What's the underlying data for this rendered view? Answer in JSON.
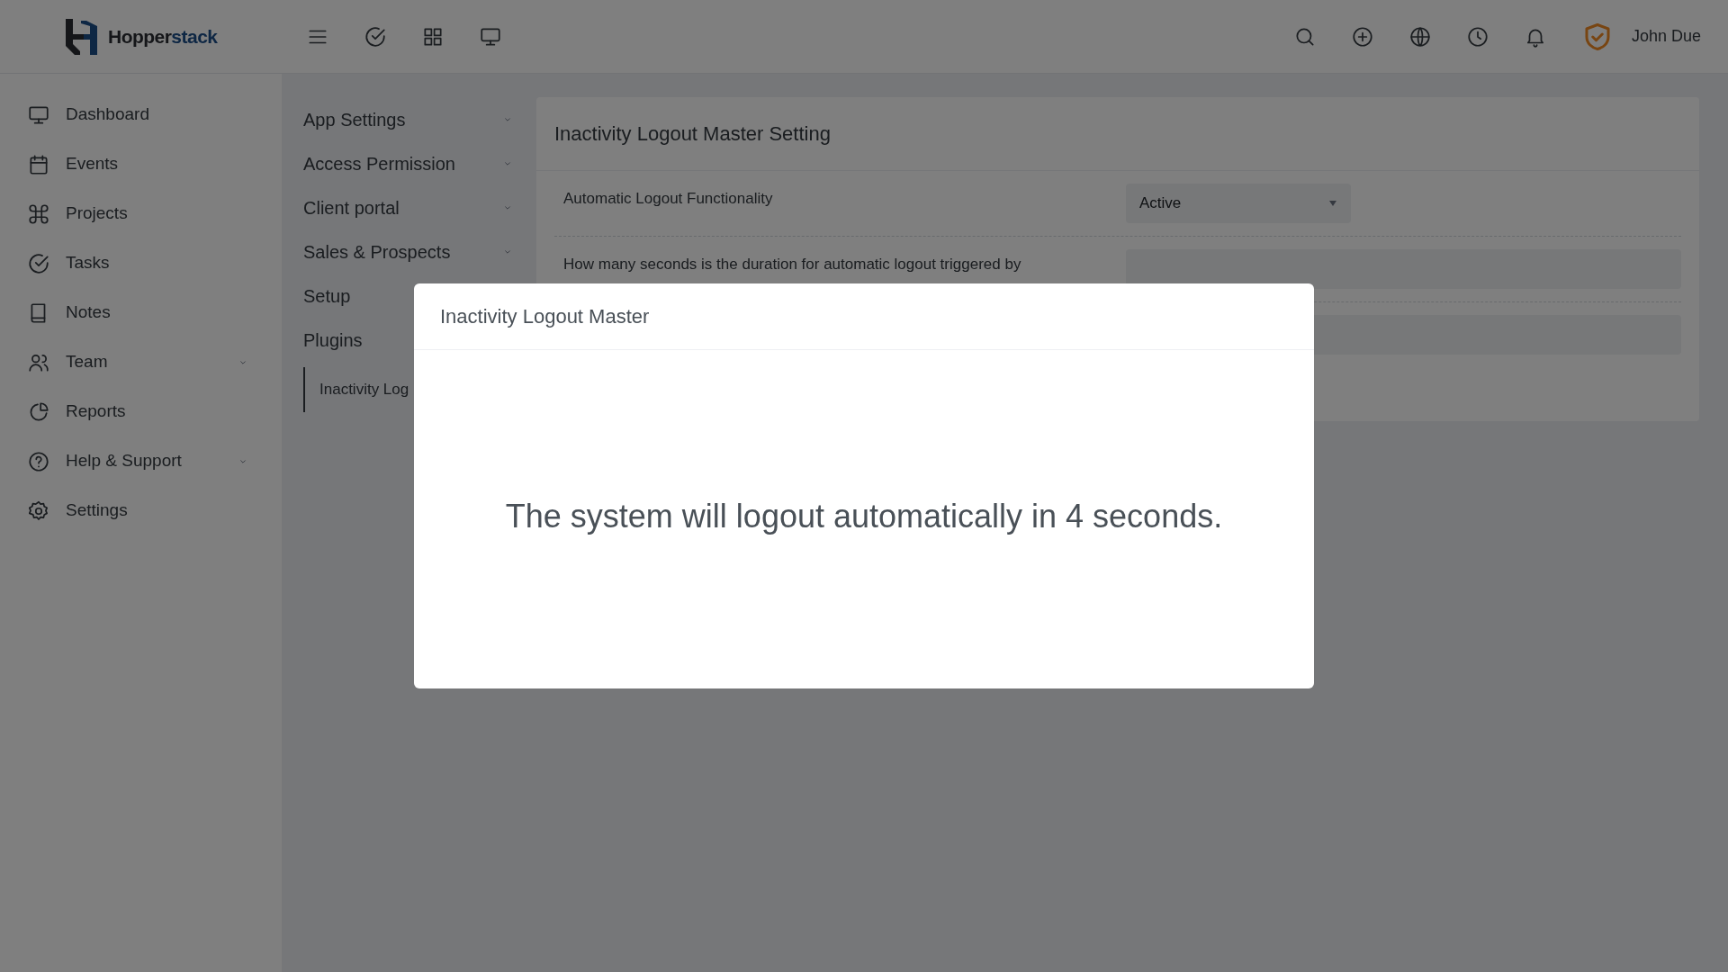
{
  "topbar": {
    "logo": {
      "part_1": "Hopper",
      "part_2": "stack"
    },
    "user": "John Due"
  },
  "sidebar": {
    "items": [
      {
        "label": "Dashboard",
        "has_submenu": false
      },
      {
        "label": "Events",
        "has_submenu": false
      },
      {
        "label": "Projects",
        "has_submenu": false
      },
      {
        "label": "Tasks",
        "has_submenu": false
      },
      {
        "label": "Notes",
        "has_submenu": false
      },
      {
        "label": "Team",
        "has_submenu": true
      },
      {
        "label": "Reports",
        "has_submenu": false
      },
      {
        "label": "Help & Support",
        "has_submenu": true
      },
      {
        "label": "Settings",
        "has_submenu": false
      }
    ]
  },
  "settings_menu": {
    "items": [
      {
        "label": "App Settings",
        "has_submenu": true
      },
      {
        "label": "Access Permission",
        "has_submenu": true
      },
      {
        "label": "Client portal",
        "has_submenu": true
      },
      {
        "label": "Sales & Prospects",
        "has_submenu": true
      },
      {
        "label": "Setup",
        "has_submenu": false
      },
      {
        "label": "Plugins",
        "has_submenu": false
      }
    ],
    "sub_items": [
      {
        "label": "Inactivity Log",
        "selected": true
      }
    ]
  },
  "panel": {
    "title": "Inactivity Logout Master Setting",
    "rows": [
      {
        "kind": "select",
        "label": "Automatic Logout Functionality",
        "value": "Active"
      },
      {
        "kind": "input",
        "label": "How many seconds is the duration for automatic logout triggered by"
      },
      {
        "kind": "input"
      }
    ]
  },
  "modal": {
    "title": "Inactivity Logout Master",
    "message": "The system will logout automatically in 4 seconds."
  }
}
